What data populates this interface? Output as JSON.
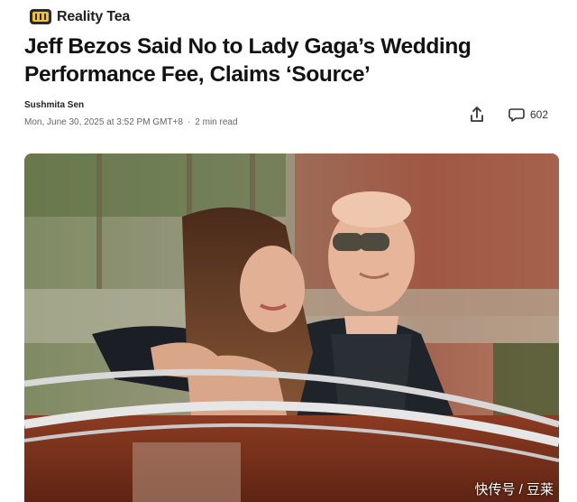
{
  "site": {
    "name": "Reality Tea",
    "logo_icon": "tv-screen-icon"
  },
  "article": {
    "headline": "Jeff Bezos Said No to Lady Gaga’s Wedding Performance Fee, Claims ‘Source’",
    "author": "Sushmita Sen",
    "date": "Mon, June 30, 2025 at 3:52 PM GMT+8",
    "separator": "·",
    "read_time": "2 min read"
  },
  "actions": {
    "share_icon": "share-icon",
    "comment_icon": "comment-icon",
    "comment_count": "602"
  },
  "watermark": {
    "text": "快传号 / 豆莱"
  },
  "colors": {
    "logo_yellow": "#f2c230",
    "logo_dark": "#2b2b2b",
    "text_primary": "#121212",
    "text_meta": "#666666"
  }
}
